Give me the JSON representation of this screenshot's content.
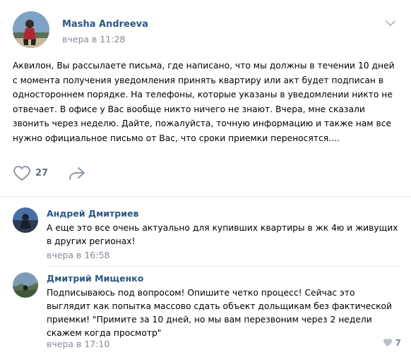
{
  "post": {
    "author": "Masha Andreeva",
    "time": "вчера в 11:28",
    "text": "Аквилон, Вы рассылаете письма, где написано, что мы должны в течении 10 дней с момента получения уведомления принять квартиру или акт будет подписан в одностороннем порядке. На телефоны, которые указаны в уведомлении никто не отвечает. В офисе у Вас вообще никто ничего не знают. Вчера, мне сказали звонить через неделю. Дайте, пожалуйста, точную информацию и также нам все нужно официальное письмо от Вас, что сроки приемки переносятся....",
    "likes": "27",
    "icons": {
      "menu": "chevron-down-icon",
      "like": "heart-icon",
      "share": "share-arrow-icon"
    }
  },
  "comments": [
    {
      "author": "Андрей Дмитриев",
      "text": "А еще это все очень актуально для купивших квартиры в жк 4ю и живущих в других регионах!",
      "time": "вчера в 16:58"
    },
    {
      "author": "Дмитрий Мищенко",
      "text": "Подписываюсь под вопросом! Опишите четко процесс! Сейчас это выглядит как попытка массово сдать объект дольщикам без фактической приемки! \"Примите за 10 дней, но мы вам перезвоним через 2 недели скажем когда просмотр\"",
      "time": "вчера в 17:10",
      "likes": "7"
    }
  ],
  "colors": {
    "link": "#2a5885",
    "muted": "#818c99",
    "background": "#ffffff"
  }
}
